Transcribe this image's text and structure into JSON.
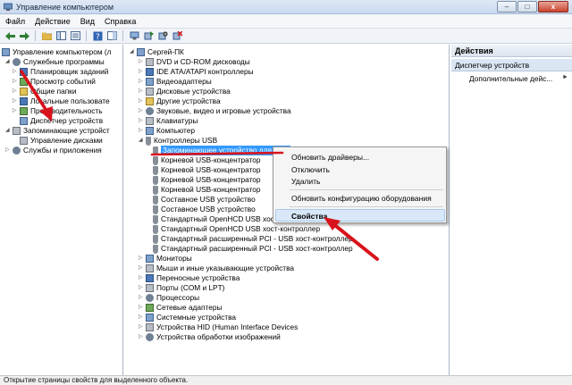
{
  "window": {
    "title": "Управление компьютером",
    "controls": {
      "minimize": "–",
      "maximize": "□",
      "close": "x"
    }
  },
  "menu": {
    "items": [
      "Файл",
      "Действие",
      "Вид",
      "Справка"
    ]
  },
  "toolbar": {
    "icons": [
      "back-arrow-icon",
      "forward-arrow-icon",
      "up-folder-icon",
      "show-hide-tree-icon",
      "properties-icon",
      "help-icon",
      "panel-icon",
      "scan-hardware-icon",
      "update-driver-icon",
      "disable-device-icon",
      "uninstall-device-icon"
    ]
  },
  "left_tree": {
    "root": "Управление компьютером (л",
    "items": [
      {
        "label": "Служебные программы"
      },
      {
        "label": "Планировщик заданий"
      },
      {
        "label": "Просмотр событий"
      },
      {
        "label": "Общие папки"
      },
      {
        "label": "Локальные пользовате"
      },
      {
        "label": "Производительность"
      },
      {
        "label": "Диспетчер устройств"
      },
      {
        "label": "Запоминающие устройст"
      },
      {
        "label": "Управление дисками"
      },
      {
        "label": "Службы и приложения"
      }
    ]
  },
  "device_tree": {
    "root": "Сергей-ПК",
    "categories_top": [
      "DVD и CD-ROM дисководы",
      "IDE ATA/ATAPI контроллеры",
      "Видеоадаптеры",
      "Дисковые устройства",
      "Другие устройства",
      "Звуковые, видео и игровые устройства",
      "Клавиатуры",
      "Компьютер",
      "Контроллеры USB"
    ],
    "usb_children": [
      "Запоминающее устройство для USB",
      "Корневой USB-концентратор",
      "Корневой USB-концентратор",
      "Корневой USB-концентратор",
      "Корневой USB-концентратор",
      "Составное USB устройство",
      "Составное USB устройство",
      "Стандартный OpenHCD USB хост-контроллер",
      "Стандартный OpenHCD USB хост-контроллер",
      "Стандартный расширенный PCI - USB хост-контроллер",
      "Стандартный расширенный PCI - USB хост-контроллер"
    ],
    "categories_bottom": [
      "Мониторы",
      "Мыши и иные указывающие устройства",
      "Переносные устройства",
      "Порты (COM и LPT)",
      "Процессоры",
      "Сетевые адаптеры",
      "Системные устройства",
      "Устройства HID (Human Interface Devices",
      "Устройства обработки изображений"
    ]
  },
  "context_menu": {
    "items": [
      "Обновить драйверы...",
      "Отключить",
      "Удалить",
      "Обновить конфигурацию оборудования",
      "Свойства"
    ]
  },
  "actions_pane": {
    "header": "Действия",
    "section": "Диспетчер устройств",
    "item": "Дополнительные дейс..."
  },
  "status_bar": {
    "text": "Открытие страницы свойств для выделенного объекта."
  },
  "colors": {
    "selection": "#3399ff",
    "annotation_red": "#d8131b",
    "menu_highlight": "#d9e8f9"
  }
}
